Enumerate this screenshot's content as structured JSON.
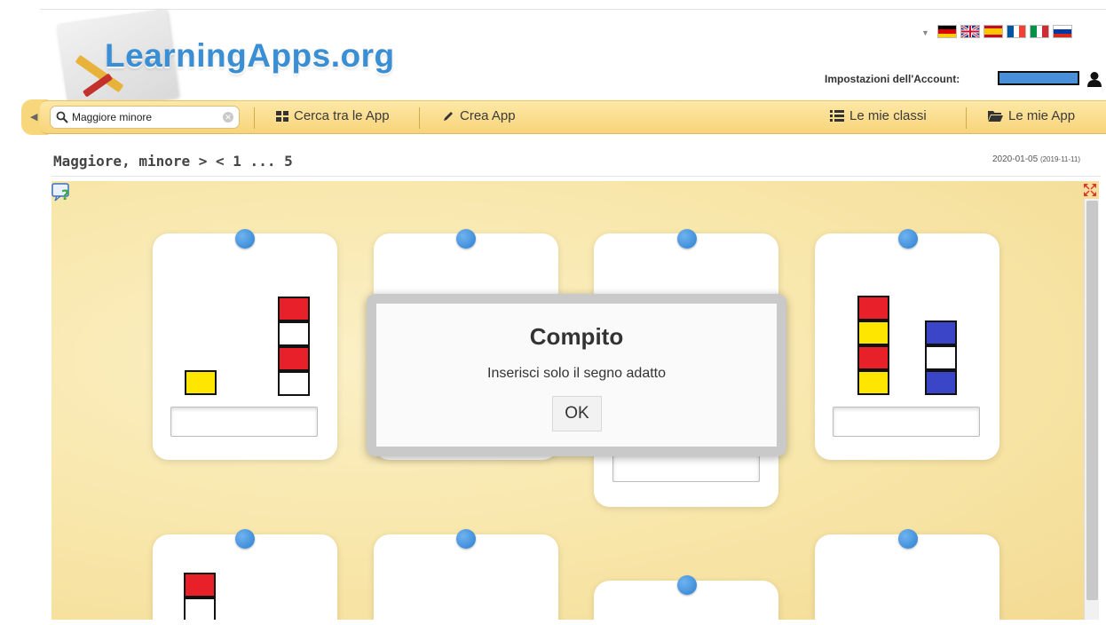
{
  "header": {
    "logo_text": "LearningApps.org",
    "account_label": "Impostazioni dell'Account:",
    "languages": [
      "german-flag",
      "uk-flag",
      "spanish-flag",
      "french-flag",
      "italian-flag",
      "russian-flag"
    ]
  },
  "nav": {
    "search_value": "Maggiore minore",
    "items": [
      {
        "label": "Cerca tra le App",
        "icon": "grid-icon"
      },
      {
        "label": "Crea App",
        "icon": "pencil-icon"
      },
      {
        "label": "Le mie classi",
        "icon": "list-icon"
      },
      {
        "label": "Le mie App",
        "icon": "folder-icon"
      }
    ]
  },
  "page": {
    "title": "Maggiore, minore > < 1 ... 5",
    "date": "2020-01-05",
    "date_created": "(2019-11-11)"
  },
  "modal": {
    "title": "Compito",
    "text": "Inserisci solo il segno adatto",
    "ok_label": "OK"
  },
  "colors": {
    "logo": "#3a8ed3",
    "nav_bar": "#f8d47a",
    "pin": "#2d7fd0",
    "block_red": "#e8202a",
    "block_yellow": "#ffe600",
    "block_blue": "#3a45c8",
    "block_white": "#ffffff"
  }
}
